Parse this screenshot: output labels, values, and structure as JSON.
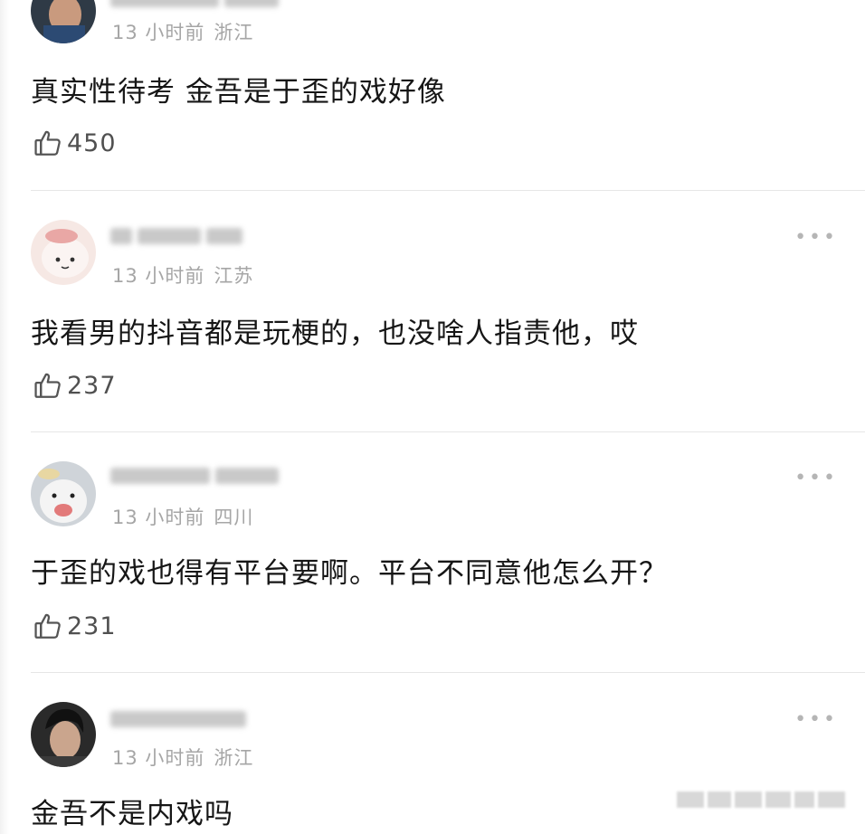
{
  "comments": [
    {
      "time": "13 小时前",
      "location": "浙江",
      "text": "真实性待考 金吾是于歪的戏好像",
      "likes": "450"
    },
    {
      "time": "13 小时前",
      "location": "江苏",
      "text": "我看男的抖音都是玩梗的，也没啥人指责他，哎",
      "likes": "237"
    },
    {
      "time": "13 小时前",
      "location": "四川",
      "text": "于歪的戏也得有平台要啊。平台不同意他怎么开？",
      "likes": "231"
    },
    {
      "time": "13 小时前",
      "location": "浙江",
      "text": "金吾不是内戏吗"
    }
  ],
  "icons": {
    "like": "thumbs-up-icon",
    "more": "more-icon"
  }
}
